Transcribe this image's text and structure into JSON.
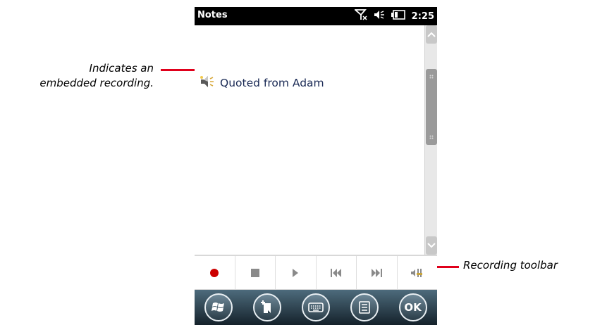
{
  "annotations": {
    "embedded_recording": "Indicates an\nembedded recording.",
    "recording_toolbar": "Recording toolbar"
  },
  "status_bar": {
    "title": "Notes",
    "time": "2:25",
    "icons": [
      "signal-off-icon",
      "volume-icon",
      "battery-icon"
    ]
  },
  "note": {
    "recording_label": "Quoted from Adam",
    "recording_icon": "speaker-recording-icon"
  },
  "recording_toolbar": {
    "buttons": [
      {
        "name": "record",
        "icon": "record-icon"
      },
      {
        "name": "stop",
        "icon": "stop-icon"
      },
      {
        "name": "play",
        "icon": "play-icon"
      },
      {
        "name": "skip-back",
        "icon": "skip-back-icon"
      },
      {
        "name": "skip-forward",
        "icon": "skip-forward-icon"
      },
      {
        "name": "volume",
        "icon": "volume-slider-icon"
      }
    ]
  },
  "softkeys": {
    "buttons": [
      "windows-start-icon",
      "new-note-icon",
      "keyboard-icon",
      "menu-icon"
    ],
    "ok_label": "OK"
  },
  "colors": {
    "accent_red": "#e0001b",
    "record_red": "#cc0000",
    "note_text": "#1a2a55"
  }
}
